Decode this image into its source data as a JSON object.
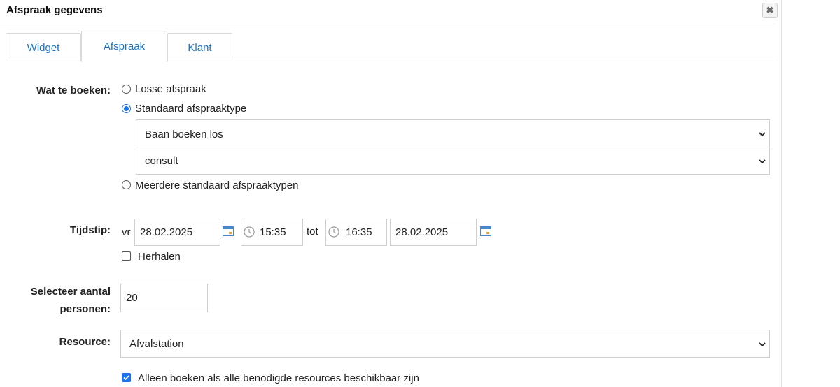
{
  "dialog": {
    "title": "Afspraak gegevens",
    "close_glyph": "✖"
  },
  "tabs": [
    {
      "label": "Widget",
      "active": false
    },
    {
      "label": "Afspraak",
      "active": true
    },
    {
      "label": "Klant",
      "active": false
    }
  ],
  "booking": {
    "label": "Wat te boeken:",
    "options": [
      {
        "label": "Losse afspraak",
        "checked": false
      },
      {
        "label": "Standaard afspraaktype",
        "checked": true
      },
      {
        "label": "Meerdere standaard afspraaktypen",
        "checked": false
      }
    ],
    "type_select": "Baan boeken los",
    "sub_select": "consult"
  },
  "time": {
    "label": "Tijdstip:",
    "weekday": "vr",
    "start_date": "28.02.2025",
    "start_time": "15:35",
    "to_label": "tot",
    "end_time": "16:35",
    "end_date": "28.02.2025",
    "repeat_label": "Herhalen",
    "repeat_checked": false
  },
  "persons": {
    "label_line1": "Selecteer aantal",
    "label_line2": "personen:",
    "value": "20"
  },
  "resource": {
    "label": "Resource:",
    "value": "Afvalstation"
  },
  "only_all_resources": {
    "label": "Alleen boeken als alle benodigde resources beschikbaar zijn",
    "checked": true
  },
  "colors": {
    "link": "#1a73c7",
    "accent": "#1a73e8",
    "border": "#cfcfcf"
  },
  "icons": {
    "close": "close-icon",
    "calendar": "calendar-icon",
    "clock": "clock-icon",
    "chevron": "chevron-down-icon"
  }
}
